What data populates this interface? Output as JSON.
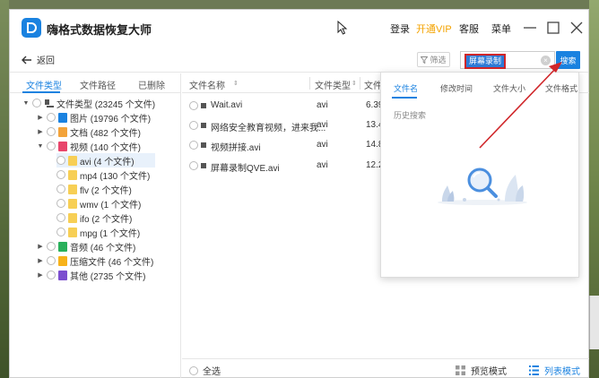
{
  "colors": {
    "accent": "#1a82e0",
    "vip": "#f4a300",
    "highlight_border": "#d0262a"
  },
  "titlebar": {
    "logo_letter": "D",
    "app_title": "嗨格式数据恢复大师",
    "login": "登录",
    "vip": "开通VIP",
    "service": "客服",
    "menu": "菜单"
  },
  "toolbar": {
    "back_label": "返回",
    "filter_label": "筛选",
    "search_value": "屏幕录制",
    "search_button": "搜索"
  },
  "sidebar": {
    "tabs": [
      "文件类型",
      "文件路径",
      "已删除"
    ],
    "tree": {
      "root": "文件类型 (23245 个文件)",
      "images": "图片 (19796 个文件)",
      "documents": "文档 (482 个文件)",
      "videos": "视频 (140 个文件)",
      "avi": "avi (4 个文件)",
      "mp4": "mp4 (130 个文件)",
      "flv": "flv (2 个文件)",
      "wmv": "wmv (1 个文件)",
      "ifo": "ifo (2 个文件)",
      "mpg": "mpg (1 个文件)",
      "audio": "音频 (46 个文件)",
      "archives": "压缩文件 (46 个文件)",
      "other": "其他 (2735 个文件)"
    }
  },
  "main": {
    "columns": {
      "name": "文件名称",
      "type": "文件类型",
      "size": "文件"
    },
    "files": [
      {
        "name": "Wait.avi",
        "type": "avi",
        "size": "6.39"
      },
      {
        "name": "网络安全教育视频，进来我...",
        "type": "avi",
        "size": "13.4"
      },
      {
        "name": "视频拼接.avi",
        "type": "avi",
        "size": "14.8"
      },
      {
        "name": "屏幕录制QVE.avi",
        "type": "avi",
        "size": "12.2"
      }
    ],
    "select_all": "全选",
    "preview_mode": "预览模式",
    "list_mode": "列表模式"
  },
  "search_dropdown": {
    "tabs": [
      "文件名",
      "修改时间",
      "文件大小",
      "文件格式"
    ],
    "history_label": "历史搜索"
  }
}
